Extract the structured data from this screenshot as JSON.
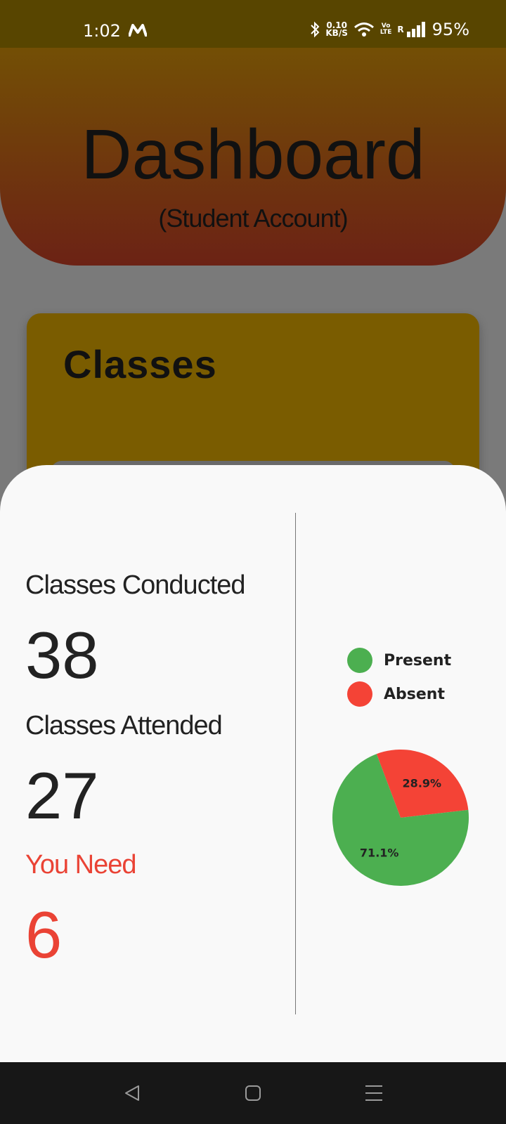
{
  "status_bar": {
    "time": "1:02",
    "carrier_icon": "m-logo-icon",
    "net_speed_value": "0.10",
    "net_speed_unit": "KB/S",
    "volte_top": "Vo",
    "volte_bottom": "LTE",
    "roaming": "R",
    "battery": "95%"
  },
  "header": {
    "title": "Dashboard",
    "subtitle": "(Student Account)"
  },
  "classes_card": {
    "title": "Classes"
  },
  "stats": {
    "conducted_label": "Classes Conducted",
    "conducted_value": "38",
    "attended_label": "Classes Attended",
    "attended_value": "27",
    "need_label": "You Need",
    "need_value": "6"
  },
  "legend": {
    "present": "Present",
    "absent": "Absent"
  },
  "colors": {
    "present": "#4caf50",
    "absent": "#f44336",
    "need": "#ea4335"
  },
  "chart_data": {
    "type": "pie",
    "categories": [
      "Present",
      "Absent"
    ],
    "values": [
      71.1,
      28.9
    ],
    "labels": [
      "71.1%",
      "28.9%"
    ],
    "colors": [
      "#4caf50",
      "#f44336"
    ],
    "legend_position": "top"
  },
  "nav_bar": {
    "back_icon": "back-triangle-icon",
    "home_icon": "home-square-icon",
    "menu_icon": "menu-lines-icon"
  }
}
